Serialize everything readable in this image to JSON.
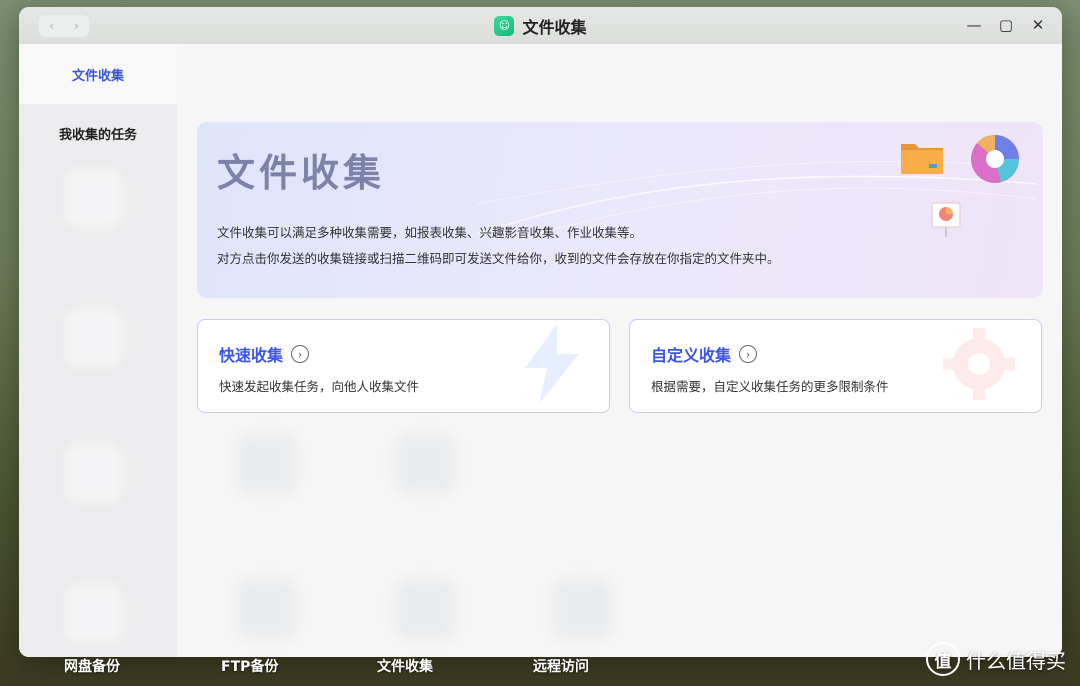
{
  "window": {
    "title": "文件收集",
    "app_icon_glyph": "☺",
    "nav_back": "‹",
    "nav_forward": "›",
    "controls": {
      "minimize": "—",
      "maximize": "▢",
      "close": "✕"
    }
  },
  "sidebar": {
    "active_item": "文件收集",
    "items": [
      {
        "label": "我收集的任务"
      }
    ]
  },
  "banner": {
    "title": "文件收集",
    "desc_line1": "文件收集可以满足多种收集需要，如报表收集、兴趣影音收集、作业收集等。",
    "desc_line2": "对方点击你发送的收集链接或扫描二维码即可发送文件给你，收到的文件会存放在你指定的文件夹中。"
  },
  "cards": [
    {
      "title": "快速收集",
      "desc": "快速发起收集任务，向他人收集文件",
      "chevron": "›",
      "icon": "lightning-icon"
    },
    {
      "title": "自定义收集",
      "desc": "根据需要，自定义收集任务的更多限制条件",
      "chevron": "›",
      "icon": "gear-icon"
    }
  ],
  "dock": {
    "items": [
      {
        "label": "网盘备份"
      },
      {
        "label": "FTP备份"
      },
      {
        "label": "文件收集"
      },
      {
        "label": "远程访问"
      }
    ]
  },
  "watermark": {
    "logo_glyph": "值",
    "text": "什么值得买"
  },
  "colors": {
    "accent": "#3a55e8",
    "banner_title": "#7d82a8",
    "card_border": "#c7ccf5"
  }
}
